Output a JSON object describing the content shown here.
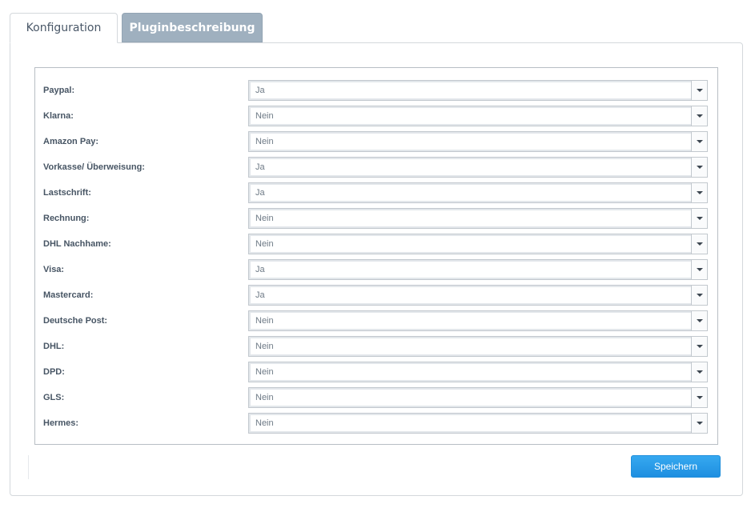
{
  "tabs": [
    {
      "label": "Konfiguration",
      "active": true
    },
    {
      "label": "Pluginbeschreibung",
      "active": false
    }
  ],
  "form": {
    "rows": [
      {
        "label": "Paypal:",
        "value": "Ja"
      },
      {
        "label": "Klarna:",
        "value": "Nein"
      },
      {
        "label": "Amazon Pay:",
        "value": "Nein"
      },
      {
        "label": "Vorkasse/ Überweisung:",
        "value": "Ja"
      },
      {
        "label": "Lastschrift:",
        "value": "Ja"
      },
      {
        "label": "Rechnung:",
        "value": "Nein"
      },
      {
        "label": "DHL Nachhame:",
        "value": "Nein"
      },
      {
        "label": "Visa:",
        "value": "Ja"
      },
      {
        "label": "Mastercard:",
        "value": "Ja"
      },
      {
        "label": "Deutsche Post:",
        "value": "Nein"
      },
      {
        "label": "DHL:",
        "value": "Nein"
      },
      {
        "label": "DPD:",
        "value": "Nein"
      },
      {
        "label": "GLS:",
        "value": "Nein"
      },
      {
        "label": "Hermes:",
        "value": "Nein"
      }
    ]
  },
  "save_label": "Speichern",
  "colors": {
    "accent": "#2196e8",
    "inactive_tab": "#9fb0bf",
    "label": "#475564"
  }
}
